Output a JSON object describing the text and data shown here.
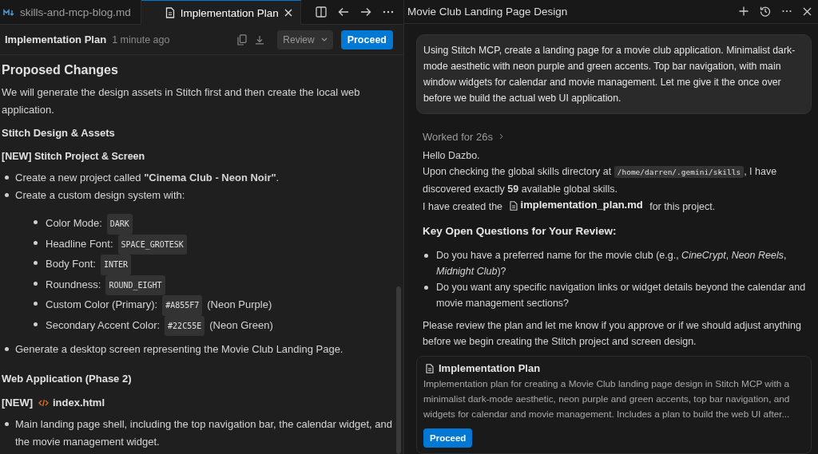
{
  "editor": {
    "tabs": [
      {
        "label": "skills-and-mcp-blog.md",
        "kind": "markdown",
        "selected": false
      },
      {
        "label": "Implementation Plan",
        "kind": "document",
        "selected": true
      }
    ],
    "toolbar": {
      "title": "Implementation Plan",
      "time": "1 minute ago",
      "review": "Review",
      "proceed": "Proceed"
    },
    "content": [
      {
        "kind": "h2",
        "text": "Proposed Changes"
      },
      {
        "kind": "p",
        "text": "We will generate the design assets in Stitch first and then create the local web application."
      },
      {
        "kind": "h3",
        "text": "Stitch Design & Assets"
      },
      {
        "kind": "h4",
        "text": "[NEW] Stitch Project & Screen"
      },
      {
        "kind": "list",
        "items": [
          {
            "text": "Create a new project called **\"Cinema Club - Neon Noir\"**."
          },
          {
            "text": "Create a custom design system with:",
            "children": [
              {
                "label": "Color Mode:",
                "code": "DARK"
              },
              {
                "label": "Headline Font:",
                "code": "SPACE_GROTESK"
              },
              {
                "label": "Body Font:",
                "code": "INTER"
              },
              {
                "label": "Roundness:",
                "code": "ROUND_EIGHT"
              },
              {
                "label": "Custom Color (Primary):",
                "code": "#A855F7",
                "note": "(Neon Purple)"
              },
              {
                "label": "Secondary Accent Color:",
                "code": "#22C55E",
                "note": "(Neon Green)"
              }
            ]
          },
          {
            "text": "Generate a desktop screen representing the Movie Club Landing Page."
          }
        ]
      },
      {
        "kind": "h3",
        "text": "Web Application (Phase 2)"
      },
      {
        "kind": "file",
        "tag": "[NEW]",
        "text": "index.html"
      },
      {
        "kind": "list",
        "items": [
          {
            "text": "Main landing page shell, including the top navigation bar, the calendar widget, and the movie management widget."
          }
        ]
      }
    ]
  },
  "chat": {
    "title": "Movie Club Landing Page Design",
    "prompt": "Using Stitch MCP, create a landing page for a movie club application. Minimalist dark-mode aesthetic with neon purple and green accents. Top bar navigation, with main window widgets for calendar and movie management.  Let me give it the once over before we build the actual web UI application.",
    "worked": "Worked for 26s",
    "greeting": "Hello Dazbo.",
    "skills": {
      "before": "Upon checking the global skills directory at",
      "code": "/home/darren/.gemini/skills",
      "after": ", I have discovered exactly **59** available global skills."
    },
    "created": {
      "before": "I have created the",
      "file": "implementation_plan.md",
      "after": "for this project."
    },
    "heading": "Key Open Questions for Your Review:",
    "questions": [
      "Do you have a preferred name for the movie club (e.g., *CineCrypt*, *Neon Reels*, *Midnight Club*)?",
      "Do you want any specific navigation links or widget details beyond the calendar and movie management sections?"
    ],
    "closing": "Please review the plan and let me know if you approve or if we should adjust anything before we begin creating the Stitch project and screen design.",
    "card": {
      "title": "Implementation Plan",
      "description": "Implementation plan for creating a Movie Club landing page design in Stitch MCP with a minimalist dark-mode aesthetic, neon purple and green accents, top bar navigation, and widgets for calendar and movie management. Includes a plan to build the web UI after...",
      "button": "Proceed"
    }
  }
}
